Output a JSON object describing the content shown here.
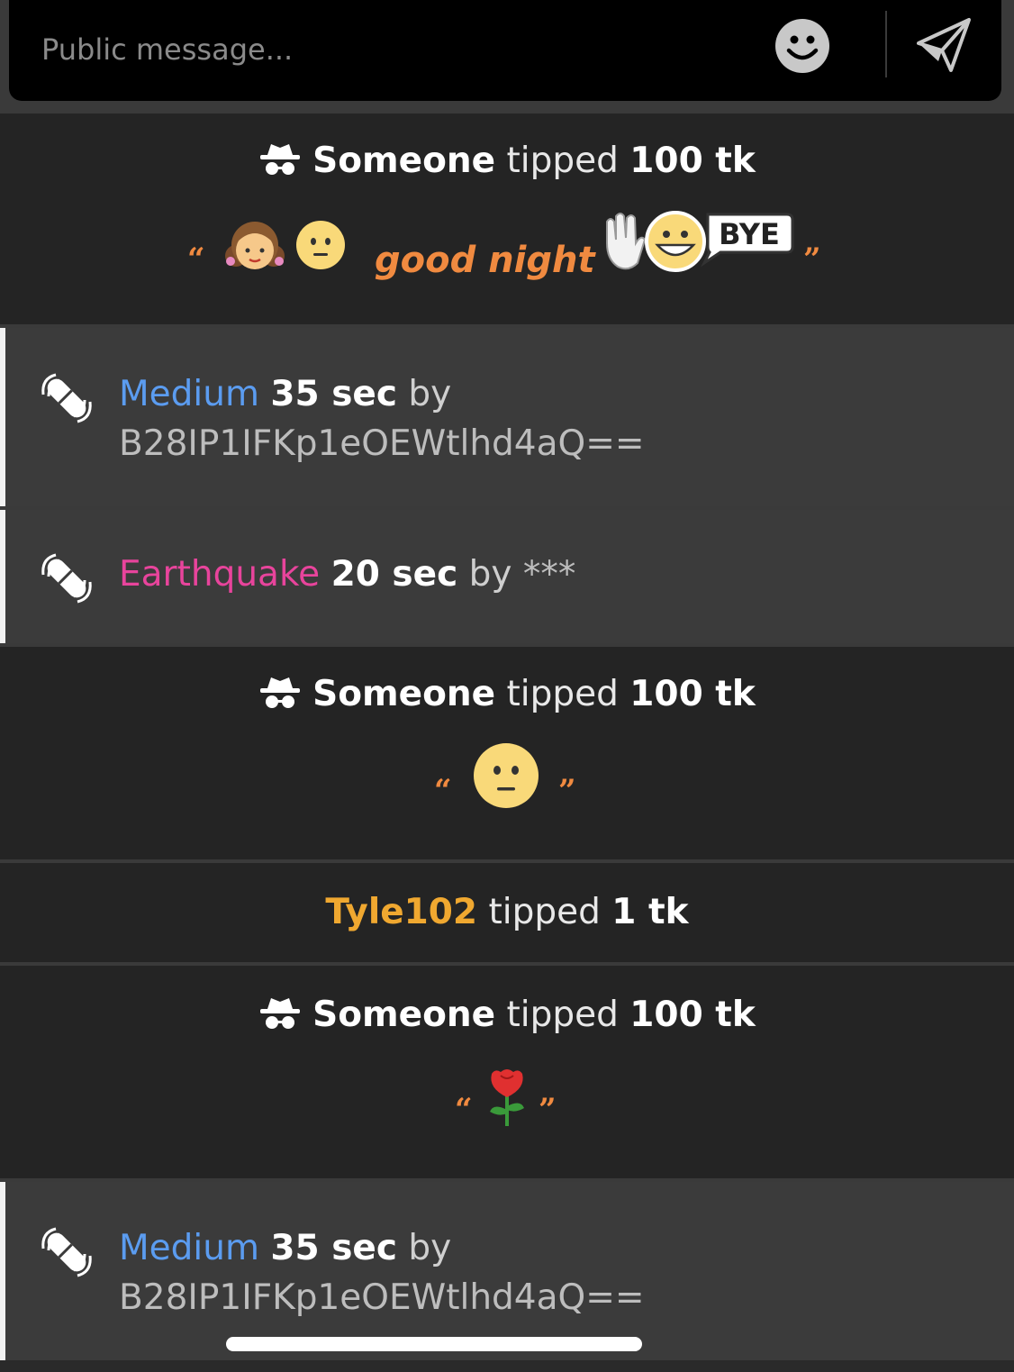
{
  "composer": {
    "placeholder": "Public message...",
    "emoji_icon": "smiley-icon",
    "send_icon": "paper-plane-icon"
  },
  "feed": [
    {
      "type": "tip",
      "tipper": "Someone",
      "verb": "tipped",
      "amount": "100 tk",
      "message": {
        "open_quote": "“",
        "text": "good night",
        "close_quote": "”",
        "emojis_before": [
          "girl-emoji",
          "neutral-face-emoji"
        ],
        "emojis_after": [
          "waving-bye-emoji"
        ],
        "sticker_text": "BYE"
      }
    },
    {
      "type": "toy",
      "level": "Medium",
      "duration": "35 sec",
      "by": "by",
      "sender": "B28IP1IFKp1eOEWtlhd4aQ=="
    },
    {
      "type": "toy",
      "level": "Earthquake",
      "duration": "20 sec",
      "by": "by",
      "sender": "***"
    },
    {
      "type": "tip",
      "tipper": "Someone",
      "verb": "tipped",
      "amount": "100 tk",
      "message": {
        "open_quote": "“",
        "close_quote": "”",
        "emojis": [
          "neutral-face-emoji"
        ]
      }
    },
    {
      "type": "tip",
      "tipper": "Tyle102",
      "verb": "tipped",
      "amount": "1 tk"
    },
    {
      "type": "tip",
      "tipper": "Someone",
      "verb": "tipped",
      "amount": "100 tk",
      "message": {
        "open_quote": "“",
        "close_quote": "”",
        "emojis": [
          "rose-emoji"
        ]
      }
    },
    {
      "type": "toy",
      "level": "Medium",
      "duration": "35 sec",
      "by": "by",
      "sender": "B28IP1IFKp1eOEWtlhd4aQ=="
    }
  ],
  "colors": {
    "level_medium": "#5b9cf0",
    "level_earthquake": "#e8449c",
    "tipper_named": "#f0a830",
    "quote": "#f08a40"
  }
}
